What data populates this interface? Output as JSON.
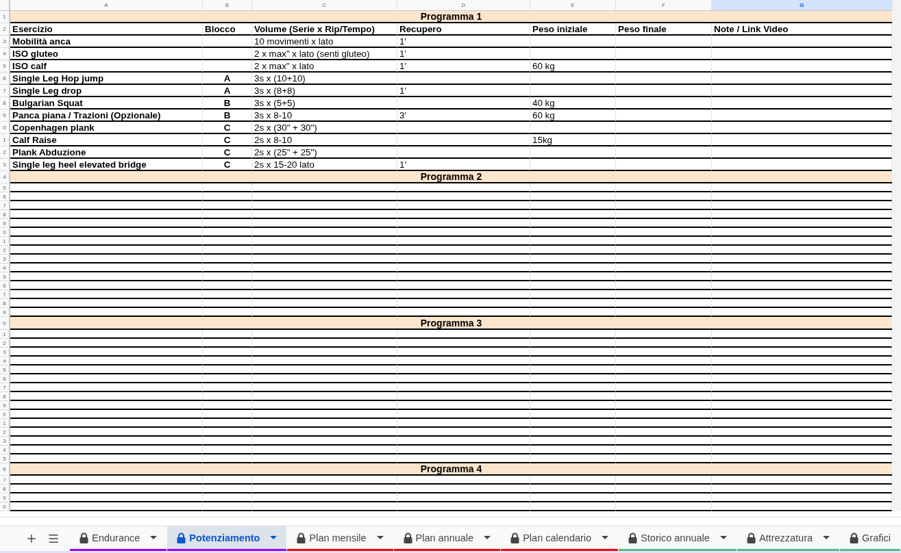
{
  "column_letters": [
    {
      "label": "A",
      "selected": false
    },
    {
      "label": "B",
      "selected": false
    },
    {
      "label": "C",
      "selected": false
    },
    {
      "label": "D",
      "selected": false
    },
    {
      "label": "E",
      "selected": false
    },
    {
      "label": "F",
      "selected": false
    },
    {
      "label": "G",
      "selected": true
    }
  ],
  "header_row": {
    "number": "2",
    "columns": [
      "Esercizio",
      "Blocco",
      "Volume (Serie x Rip/Tempo)",
      "Recupero",
      "Peso iniziale",
      "Peso finale",
      "Note / Link Video"
    ]
  },
  "sections": [
    {
      "number": "1",
      "title": "Programma 1",
      "rows": [
        {
          "number": "3",
          "exercise": "Mobilità anca",
          "volume": "10 movimenti x lato",
          "rest": "1'"
        },
        {
          "number": "4",
          "exercise": "ISO gluteo",
          "volume": "2 x max\" x lato (senti gluteo)",
          "rest": "1'"
        },
        {
          "number": "5",
          "exercise": "ISO calf",
          "volume": "2 x max\" x lato",
          "rest": "1'",
          "start_weight": "60 kg"
        },
        {
          "number": "6",
          "exercise": "Single Leg Hop jump",
          "block": "A",
          "volume": "3s x (10+10)"
        },
        {
          "number": "7",
          "exercise": "Single Leg drop",
          "block": "A",
          "volume": "3s x (8+8)",
          "rest": "1'"
        },
        {
          "number": "8",
          "exercise": "Bulgarian Squat",
          "block": "B",
          "volume": "3s x (5+5)",
          "start_weight": "40 kg"
        },
        {
          "number": "9",
          "exercise": "Panca piana / Trazioni (Opzionale)",
          "block": "B",
          "volume": "3s x 8-10",
          "rest": "3'",
          "start_weight": "60 kg"
        },
        {
          "number": "0",
          "exercise": "Copenhagen plank",
          "block": "C",
          "volume": "2s x (30\" + 30\")"
        },
        {
          "number": "1",
          "exercise": "Calf Raise",
          "block": "C",
          "volume": "2s x 8-10",
          "start_weight": "15kg"
        },
        {
          "number": "2",
          "exercise": "Plank Abduzione",
          "block": "C",
          "volume": "2s x (25\" + 25\")"
        },
        {
          "number": "3",
          "exercise": "Single leg heel elevated bridge",
          "block": "C",
          "volume": "2s x 15-20 lato",
          "rest": "1'"
        }
      ]
    },
    {
      "number": "4",
      "title": "Programma 2",
      "rows": [
        {
          "number": "5"
        },
        {
          "number": "6"
        },
        {
          "number": "7"
        },
        {
          "number": "8"
        },
        {
          "number": "9"
        },
        {
          "number": "0"
        },
        {
          "number": "1"
        },
        {
          "number": "2"
        },
        {
          "number": "3"
        },
        {
          "number": "4"
        },
        {
          "number": "5"
        },
        {
          "number": "6"
        },
        {
          "number": "7"
        },
        {
          "number": "8"
        },
        {
          "number": "9"
        }
      ]
    },
    {
      "number": "0",
      "title": "Programma 3",
      "rows": [
        {
          "number": "1"
        },
        {
          "number": "2"
        },
        {
          "number": "3"
        },
        {
          "number": "4"
        },
        {
          "number": "5"
        },
        {
          "number": "6"
        },
        {
          "number": "7"
        },
        {
          "number": "8"
        },
        {
          "number": "9"
        },
        {
          "number": "0"
        },
        {
          "number": "1"
        },
        {
          "number": "2"
        },
        {
          "number": "3"
        },
        {
          "number": "4"
        },
        {
          "number": "5"
        }
      ]
    },
    {
      "number": "6",
      "title": "Programma 4",
      "rows": [
        {
          "number": "7"
        },
        {
          "number": "8"
        },
        {
          "number": "9"
        },
        {
          "number": "0"
        }
      ]
    }
  ],
  "sheet_tabs": [
    {
      "label": "Endurance",
      "selected": false,
      "color": "#9900ff"
    },
    {
      "label": "Potenziamento",
      "selected": true,
      "color": "#9900ff"
    },
    {
      "label": "Plan mensile",
      "selected": false,
      "color": "#ff0000"
    },
    {
      "label": "Plan annuale",
      "selected": false,
      "color": "#ff0000"
    },
    {
      "label": "Plan calendario",
      "selected": false,
      "color": "#ff0000"
    },
    {
      "label": "Storico annuale",
      "selected": false,
      "color": "#57bb8a"
    },
    {
      "label": "Attrezzatura",
      "selected": false,
      "color": "#57bb8a"
    },
    {
      "label": "Grafici",
      "selected": false,
      "color": "#57bb8a"
    }
  ]
}
